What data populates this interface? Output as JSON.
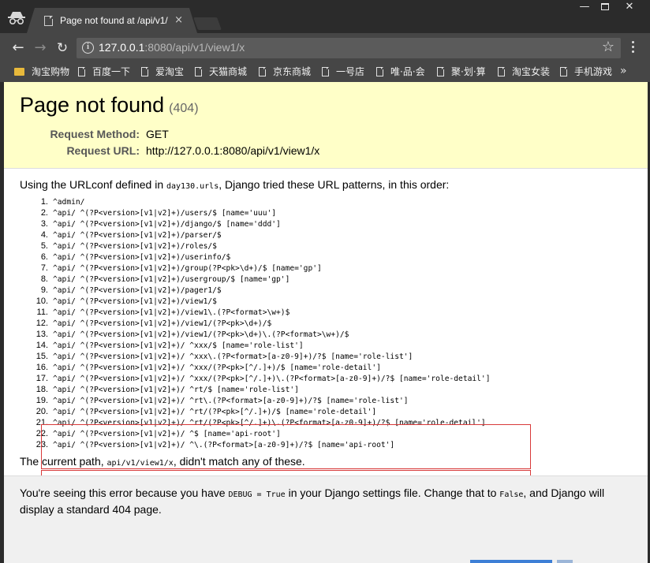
{
  "browser": {
    "tab_title": "Page not found at /api/v1/",
    "tab_close": "×",
    "window_buttons": {
      "minimize": "—",
      "close": "✕"
    },
    "url_host": "127.0.0.1",
    "url_rest": ":8080/api/v1/view1/x",
    "nav": {
      "back": "←",
      "forward": "→",
      "reload": "↻",
      "star": "☆",
      "more": "»"
    },
    "bookmarks": [
      {
        "label": "淘宝购物",
        "icon": "folder-icon"
      },
      {
        "label": "百度一下",
        "icon": "page-icon"
      },
      {
        "label": "爱淘宝",
        "icon": "page-icon"
      },
      {
        "label": "天猫商城",
        "icon": "page-icon"
      },
      {
        "label": "京东商城",
        "icon": "page-icon"
      },
      {
        "label": "一号店",
        "icon": "page-icon"
      },
      {
        "label": "唯·品·会",
        "icon": "page-icon"
      },
      {
        "label": "聚·划·算",
        "icon": "page-icon"
      },
      {
        "label": "淘宝女装",
        "icon": "page-icon"
      },
      {
        "label": "手机游戏",
        "icon": "page-icon"
      }
    ]
  },
  "page": {
    "title": "Page not found",
    "status": "(404)",
    "request_method_label": "Request Method:",
    "request_method": "GET",
    "request_url_label": "Request URL:",
    "request_url": "http://127.0.0.1:8080/api/v1/view1/x",
    "intro_before": "Using the URLconf defined in ",
    "intro_module": "day130.urls",
    "intro_after": ", Django tried these URL patterns, in this order:",
    "patterns": [
      {
        "n": "1.",
        "p": "^admin/"
      },
      {
        "n": "2.",
        "p": "^api/ ^(?P<version>[v1|v2]+)/users/$ [name='uuu']"
      },
      {
        "n": "3.",
        "p": "^api/ ^(?P<version>[v1|v2]+)/django/$ [name='ddd']"
      },
      {
        "n": "4.",
        "p": "^api/ ^(?P<version>[v1|v2]+)/parser/$"
      },
      {
        "n": "5.",
        "p": "^api/ ^(?P<version>[v1|v2]+)/roles/$"
      },
      {
        "n": "6.",
        "p": "^api/ ^(?P<version>[v1|v2]+)/userinfo/$"
      },
      {
        "n": "7.",
        "p": "^api/ ^(?P<version>[v1|v2]+)/group(?P<pk>\\d+)/$ [name='gp']"
      },
      {
        "n": "8.",
        "p": "^api/ ^(?P<version>[v1|v2]+)/usergroup/$ [name='gp']"
      },
      {
        "n": "9.",
        "p": "^api/ ^(?P<version>[v1|v2]+)/pager1/$"
      },
      {
        "n": "10.",
        "p": "^api/ ^(?P<version>[v1|v2]+)/view1/$"
      },
      {
        "n": "11.",
        "p": "^api/ ^(?P<version>[v1|v2]+)/view1\\.(?P<format>\\w+)$"
      },
      {
        "n": "12.",
        "p": "^api/ ^(?P<version>[v1|v2]+)/view1/(?P<pk>\\d+)/$"
      },
      {
        "n": "13.",
        "p": "^api/ ^(?P<version>[v1|v2]+)/view1/(?P<pk>\\d+)\\.(?P<format>\\w+)/$"
      },
      {
        "n": "14.",
        "p": "^api/ ^(?P<version>[v1|v2]+)/ ^xxx/$ [name='role-list']"
      },
      {
        "n": "15.",
        "p": "^api/ ^(?P<version>[v1|v2]+)/ ^xxx\\.(?P<format>[a-z0-9]+)/?$ [name='role-list']"
      },
      {
        "n": "16.",
        "p": "^api/ ^(?P<version>[v1|v2]+)/ ^xxx/(?P<pk>[^/.]+)/$ [name='role-detail']"
      },
      {
        "n": "17.",
        "p": "^api/ ^(?P<version>[v1|v2]+)/ ^xxx/(?P<pk>[^/.]+)\\.(?P<format>[a-z0-9]+)/?$ [name='role-detail']"
      },
      {
        "n": "18.",
        "p": "^api/ ^(?P<version>[v1|v2]+)/ ^rt/$ [name='role-list']"
      },
      {
        "n": "19.",
        "p": "^api/ ^(?P<version>[v1|v2]+)/ ^rt\\.(?P<format>[a-z0-9]+)/?$ [name='role-list']"
      },
      {
        "n": "20.",
        "p": "^api/ ^(?P<version>[v1|v2]+)/ ^rt/(?P<pk>[^/.]+)/$ [name='role-detail']"
      },
      {
        "n": "21.",
        "p": "^api/ ^(?P<version>[v1|v2]+)/ ^rt/(?P<pk>[^/.]+)\\.(?P<format>[a-z0-9]+)/?$ [name='role-detail']"
      },
      {
        "n": "22.",
        "p": "^api/ ^(?P<version>[v1|v2]+)/ ^$ [name='api-root']"
      },
      {
        "n": "23.",
        "p": "^api/ ^(?P<version>[v1|v2]+)/ ^\\.(?P<format>[a-z0-9]+)/?$ [name='api-root']"
      }
    ],
    "outro_before": "The current path, ",
    "outro_path": "api/v1/view1/x",
    "outro_after": ", didn't match any of these.",
    "expl_1": "You're seeing this error because you have ",
    "expl_code_1": "DEBUG = True",
    "expl_2": " in your Django settings file. Change that to ",
    "expl_code_2": "False",
    "expl_3": ", and Django will display a standard 404 page."
  },
  "colors": {
    "summary_bg": "#ffffc8",
    "highlight_border": "#d83a3a",
    "chrome_dark": "#2b2b2b",
    "chrome_toolbar": "#464646"
  }
}
